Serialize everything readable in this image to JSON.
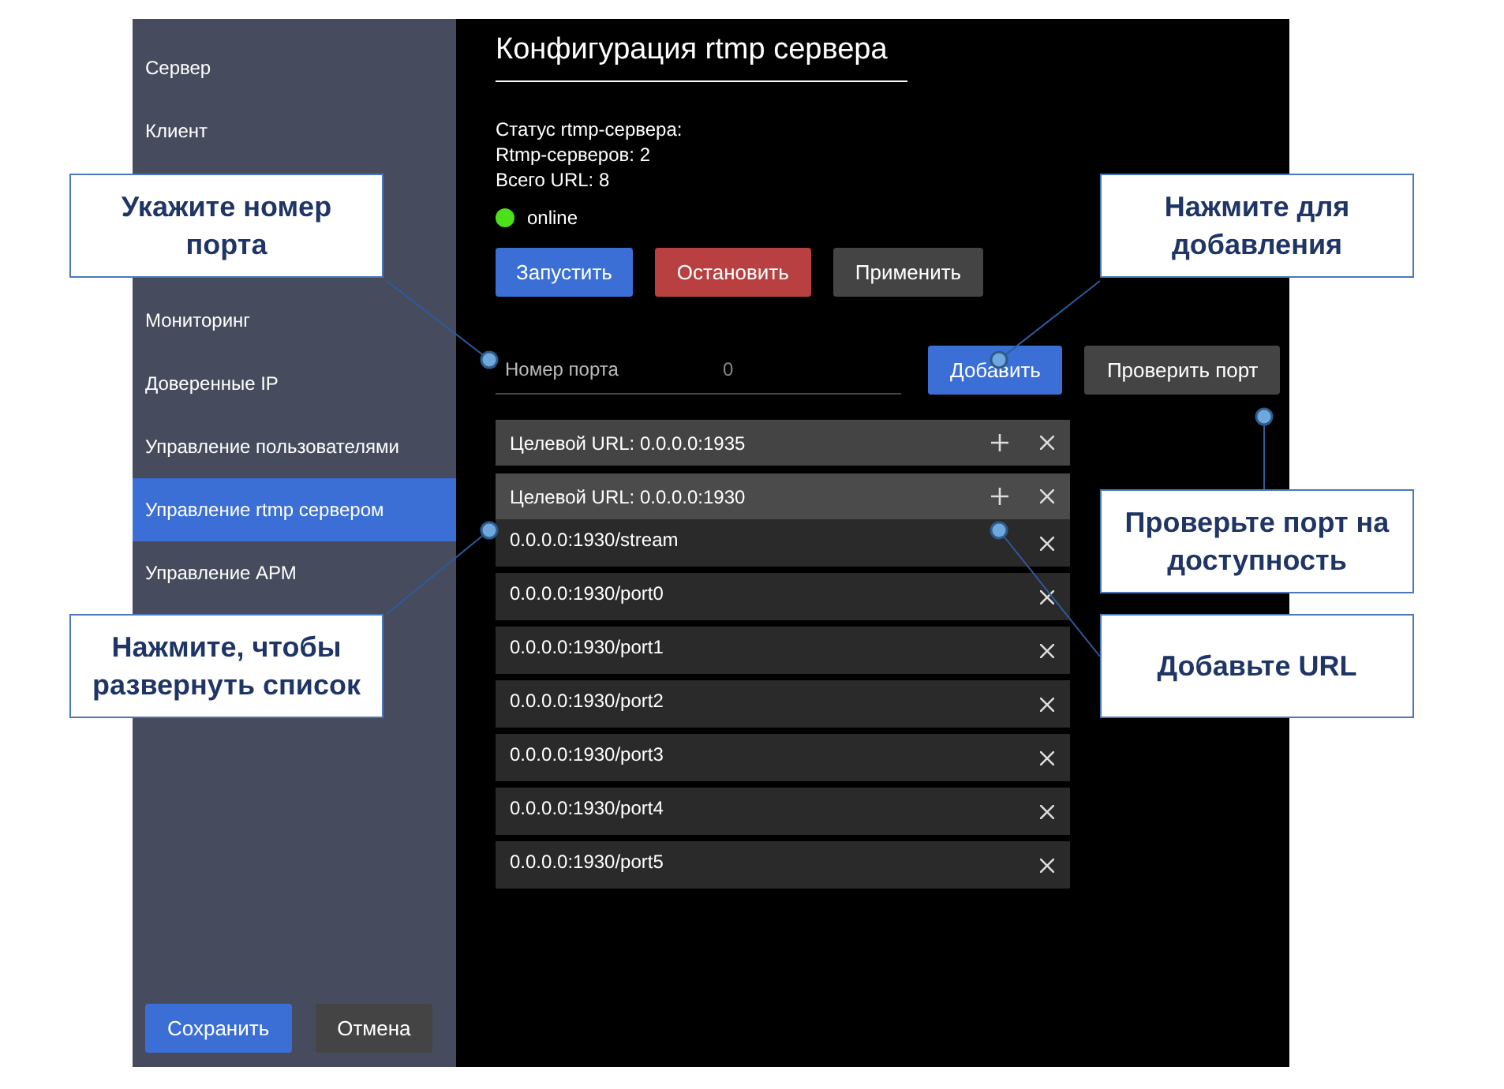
{
  "sidebar": {
    "items": [
      {
        "label": "Сервер",
        "selected": false
      },
      {
        "label": "Клиент",
        "selected": false
      },
      {
        "label": "Мониторинг",
        "selected": false
      },
      {
        "label": "Доверенные IP",
        "selected": false
      },
      {
        "label": "Управление пользователями",
        "selected": false
      },
      {
        "label": "Управление rtmp сервером",
        "selected": true
      },
      {
        "label": "Управление АРМ",
        "selected": false
      }
    ],
    "buttons": [
      {
        "label": "Сохранить",
        "kind": "primary"
      },
      {
        "label": "Отмена",
        "kind": "secondary"
      }
    ]
  },
  "main": {
    "title": "Конфигурация rtmp сервера",
    "status_lines": [
      "Статус rtmp-сервера:",
      "Rtmp-серверов: 2",
      "Всего URL: 8"
    ],
    "status": {
      "label": "online",
      "color": "#4be01a"
    },
    "actions": [
      {
        "label": "Запустить",
        "kind": "primary"
      },
      {
        "label": "Остановить",
        "kind": "danger"
      },
      {
        "label": "Применить",
        "kind": "secondary"
      }
    ],
    "port_field": {
      "label": "Номер порта",
      "placeholder": "0"
    },
    "port_buttons": [
      {
        "label": "Добавить",
        "kind": "primary"
      },
      {
        "label": "Проверить порт",
        "kind": "secondary"
      }
    ],
    "targets": [
      {
        "label": "Целевой URL: 0.0.0.0:1935"
      },
      {
        "label": "Целевой URL: 0.0.0.0:1930",
        "expanded": true,
        "urls": [
          "0.0.0.0:1930/stream",
          "0.0.0.0:1930/port0",
          "0.0.0.0:1930/port1",
          "0.0.0.0:1930/port2",
          "0.0.0.0:1930/port3",
          "0.0.0.0:1930/port4",
          "0.0.0.0:1930/port5"
        ]
      }
    ]
  },
  "callouts": [
    "Укажите номер порта",
    "Нажмите для добавления",
    "Проверьте порт на доступность",
    "Нажмите, чтобы развернуть список",
    "Добавьте URL"
  ]
}
